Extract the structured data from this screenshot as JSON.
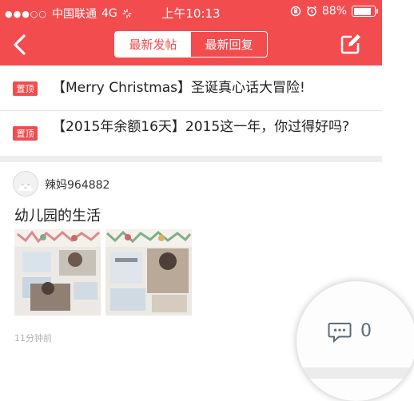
{
  "status_bar": {
    "carrier": "中国联通",
    "network": "4G",
    "time": "上午10:13",
    "battery_percent": "88%",
    "battery_level": 0.88
  },
  "nav": {
    "tabs": [
      {
        "label": "最新发帖",
        "active": true
      },
      {
        "label": "最新回复",
        "active": false
      }
    ],
    "back_icon": "chevron-left-icon",
    "edit_icon": "edit-icon"
  },
  "pinned": [
    {
      "tag": "置顶",
      "title": "【Merry Christmas】圣诞真心话大冒险!"
    },
    {
      "tag": "置顶",
      "title": "【2015年余额16天】2015这一年，你过得好吗?"
    }
  ],
  "post": {
    "username": "辣妈964882",
    "title": "幼儿园的生活",
    "time": "11分钟前",
    "comment_count": "0"
  },
  "colors": {
    "brand_red": "#f34c4f",
    "tag_red": "#f34c4f",
    "separator": "#efeff2",
    "icon_gray": "#5d6a75"
  }
}
